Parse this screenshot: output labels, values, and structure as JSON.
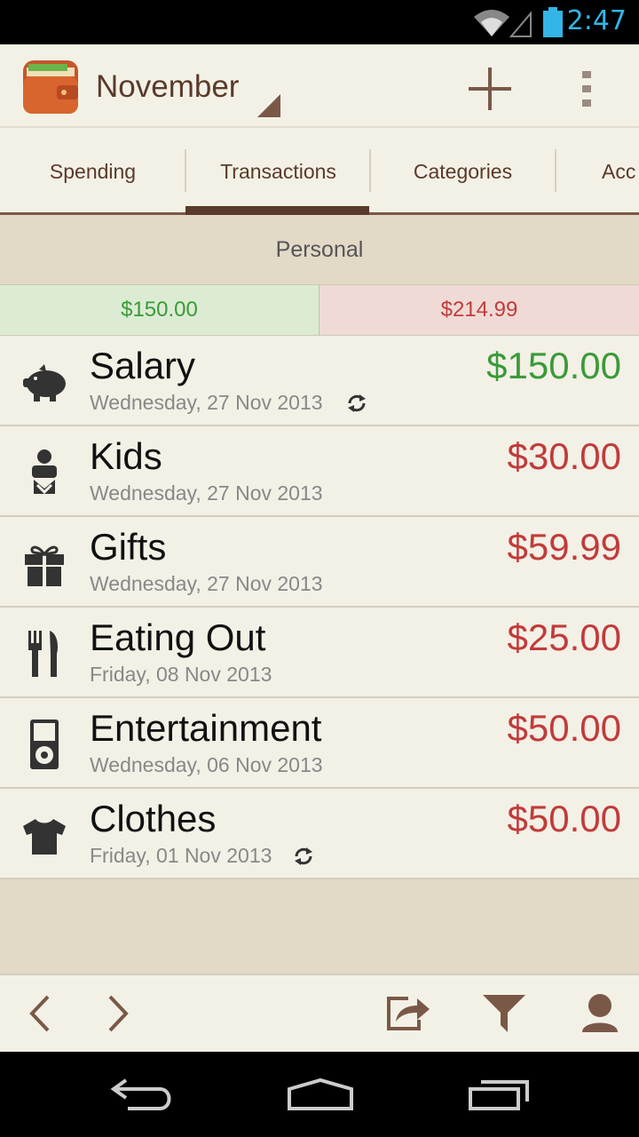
{
  "status_bar": {
    "time": "2:47"
  },
  "header": {
    "month": "November"
  },
  "tabs": [
    {
      "label": "Spending"
    },
    {
      "label": "Transactions"
    },
    {
      "label": "Categories"
    },
    {
      "label": "Acc"
    }
  ],
  "group": {
    "title": "Personal"
  },
  "totals": {
    "income": "$150.00",
    "expense": "$214.99"
  },
  "transactions": [
    {
      "name": "Salary",
      "date": "Wednesday, 27 Nov 2013",
      "amount": "$150.00",
      "type": "income",
      "icon": "piggy-bank-icon",
      "recurring": true
    },
    {
      "name": "Kids",
      "date": "Wednesday, 27 Nov 2013",
      "amount": "$30.00",
      "type": "expense",
      "icon": "baby-icon",
      "recurring": false
    },
    {
      "name": "Gifts",
      "date": "Wednesday, 27 Nov 2013",
      "amount": "$59.99",
      "type": "expense",
      "icon": "gift-icon",
      "recurring": false
    },
    {
      "name": "Eating Out",
      "date": "Friday, 08 Nov 2013",
      "amount": "$25.00",
      "type": "expense",
      "icon": "fork-knife-icon",
      "recurring": false
    },
    {
      "name": "Entertainment",
      "date": "Wednesday, 06 Nov 2013",
      "amount": "$50.00",
      "type": "expense",
      "icon": "music-player-icon",
      "recurring": false
    },
    {
      "name": "Clothes",
      "date": "Friday, 01 Nov 2013",
      "amount": "$50.00",
      "type": "expense",
      "icon": "tshirt-icon",
      "recurring": true
    }
  ],
  "colors": {
    "income": "#3a9a3a",
    "expense": "#c13b3b",
    "brand_brown": "#5a3a2a",
    "status_blue": "#33b5e5"
  }
}
